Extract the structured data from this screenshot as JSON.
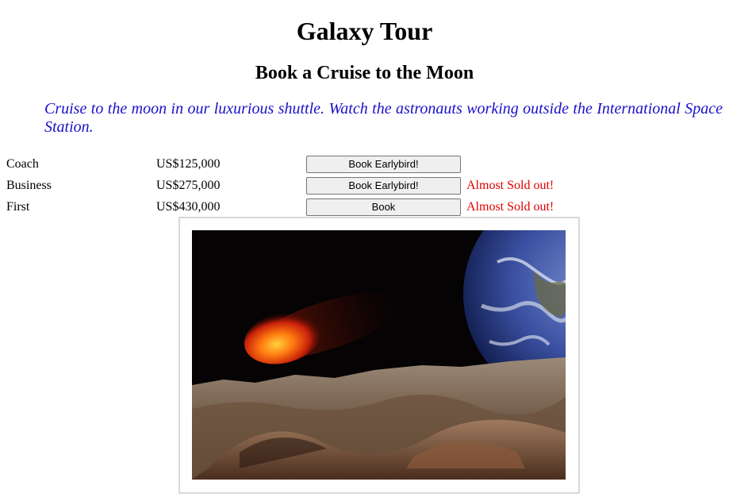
{
  "header": {
    "title": "Galaxy Tour",
    "subtitle": "Book a Cruise to the Moon",
    "tagline": "Cruise to the moon in our luxurious shuttle. Watch the astronauts working outside the International Space Station."
  },
  "fares": [
    {
      "class": "Coach",
      "price": "US$125,000",
      "button": "Book Earlybird!",
      "note": ""
    },
    {
      "class": "Business",
      "price": "US$275,000",
      "button": "Book Earlybird!",
      "note": "Almost Sold out!"
    },
    {
      "class": "First",
      "price": "US$430,000",
      "button": "Book",
      "note": "Almost Sold out!"
    }
  ],
  "colors": {
    "tagline": "#1a10c8",
    "warning": "#e10000"
  },
  "image": {
    "subject": "moon-landscape-with-earth-and-fireball"
  }
}
